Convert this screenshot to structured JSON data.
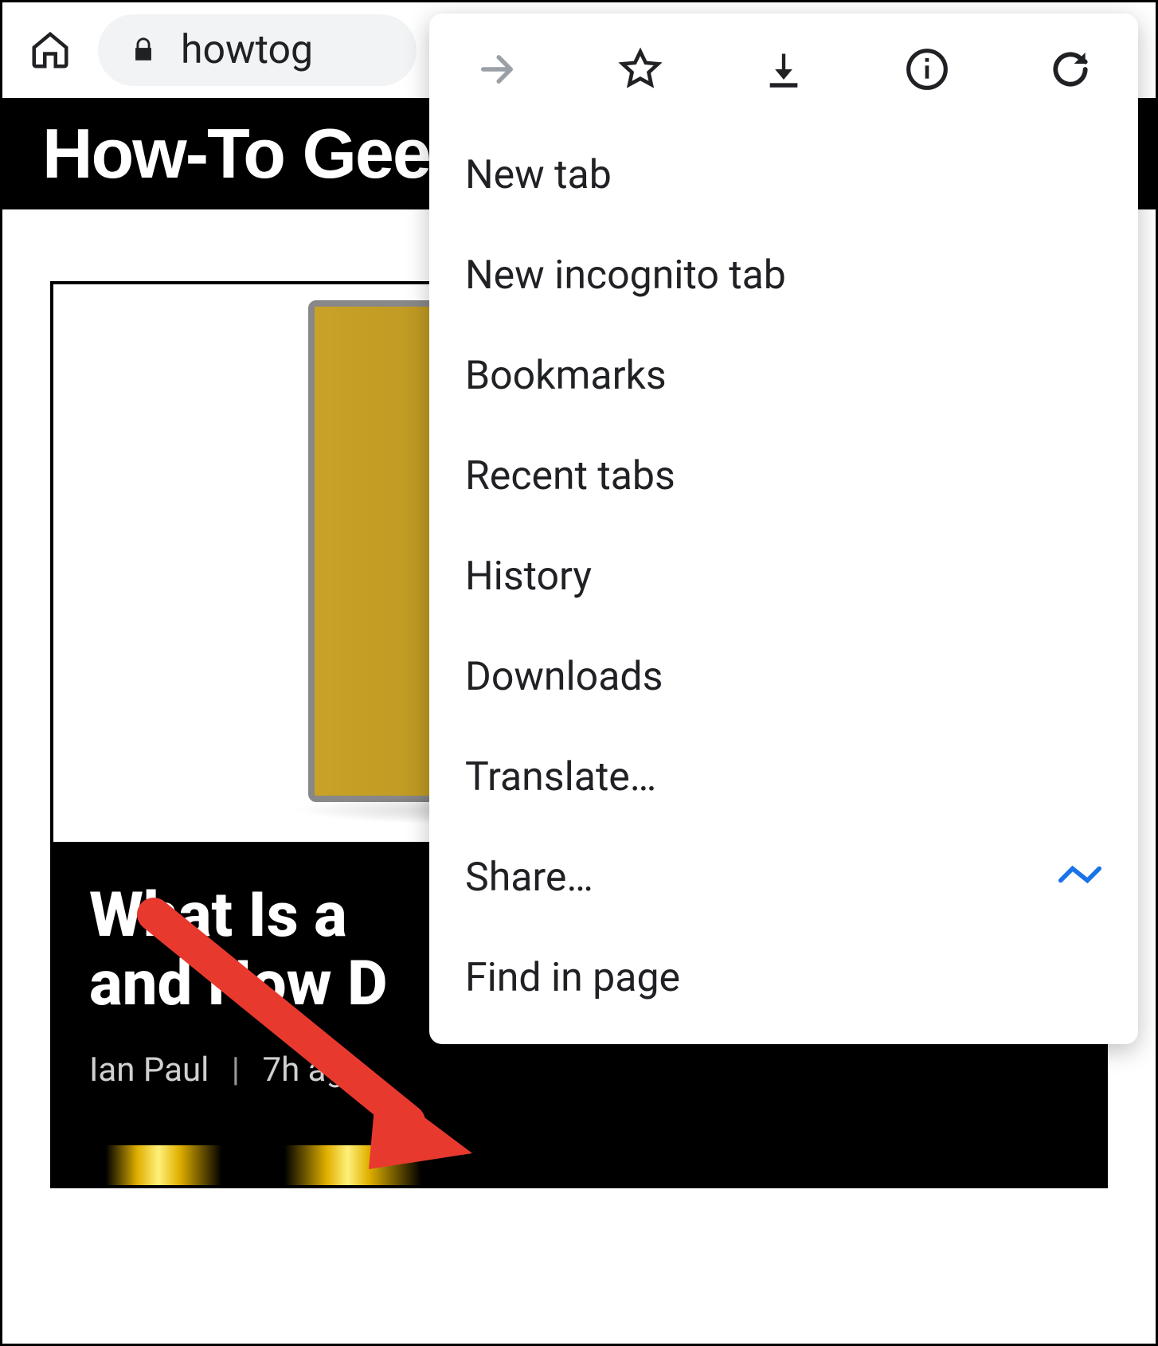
{
  "toolbar": {
    "url_display": "howtog"
  },
  "page": {
    "site_title": "How-To Geek",
    "article_title_line1": "What Is a",
    "article_title_line2": "and How D",
    "author": "Ian Paul",
    "time_ago": "7h ago"
  },
  "menu": {
    "items": {
      "new_tab": "New tab",
      "new_incognito": "New incognito tab",
      "bookmarks": "Bookmarks",
      "recent_tabs": "Recent tabs",
      "history": "History",
      "downloads": "Downloads",
      "translate": "Translate…",
      "share": "Share…",
      "find_in_page": "Find in page"
    }
  }
}
